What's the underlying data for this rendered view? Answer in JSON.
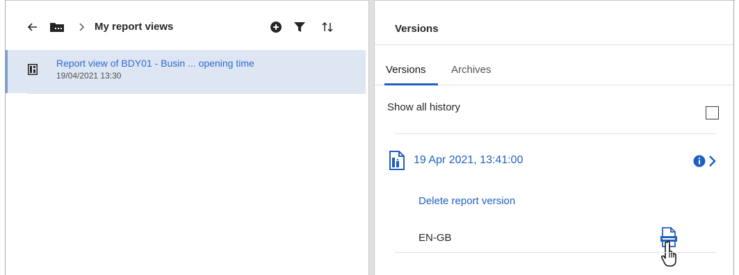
{
  "left_panel": {
    "breadcrumb": {
      "back_icon": "arrow-left-icon",
      "folder_icon": "folder-icon",
      "separator": ">",
      "title": "My report views"
    },
    "toolbar": {
      "add_icon": "add-circle-icon",
      "filter_icon": "filter-icon",
      "sort_icon": "sort-icon"
    },
    "report_views": [
      {
        "icon": "report-view-icon",
        "title": "Report view of BDY01 - Busin ... opening time",
        "date": "19/04/2021 13:30"
      }
    ]
  },
  "right_panel": {
    "title": "Versions",
    "tabs": [
      {
        "label": "Versions",
        "active": true
      },
      {
        "label": "Archives",
        "active": false
      }
    ],
    "history": {
      "label": "Show all history",
      "checked": false
    },
    "version_entry": {
      "icon": "report-document-icon",
      "timestamp": "19 Apr 2021, 13:41:00",
      "info_icon": "info-icon",
      "expand_icon": "chevron-right-icon",
      "delete_label": "Delete report version",
      "outputs": [
        {
          "language": "EN-GB",
          "format_icon": "html-file-icon"
        }
      ]
    }
  },
  "colors": {
    "accent": "#1f5fbf",
    "selected_row_bg": "#dde6f2",
    "divider": "#e0e0e0",
    "text": "#262626"
  }
}
